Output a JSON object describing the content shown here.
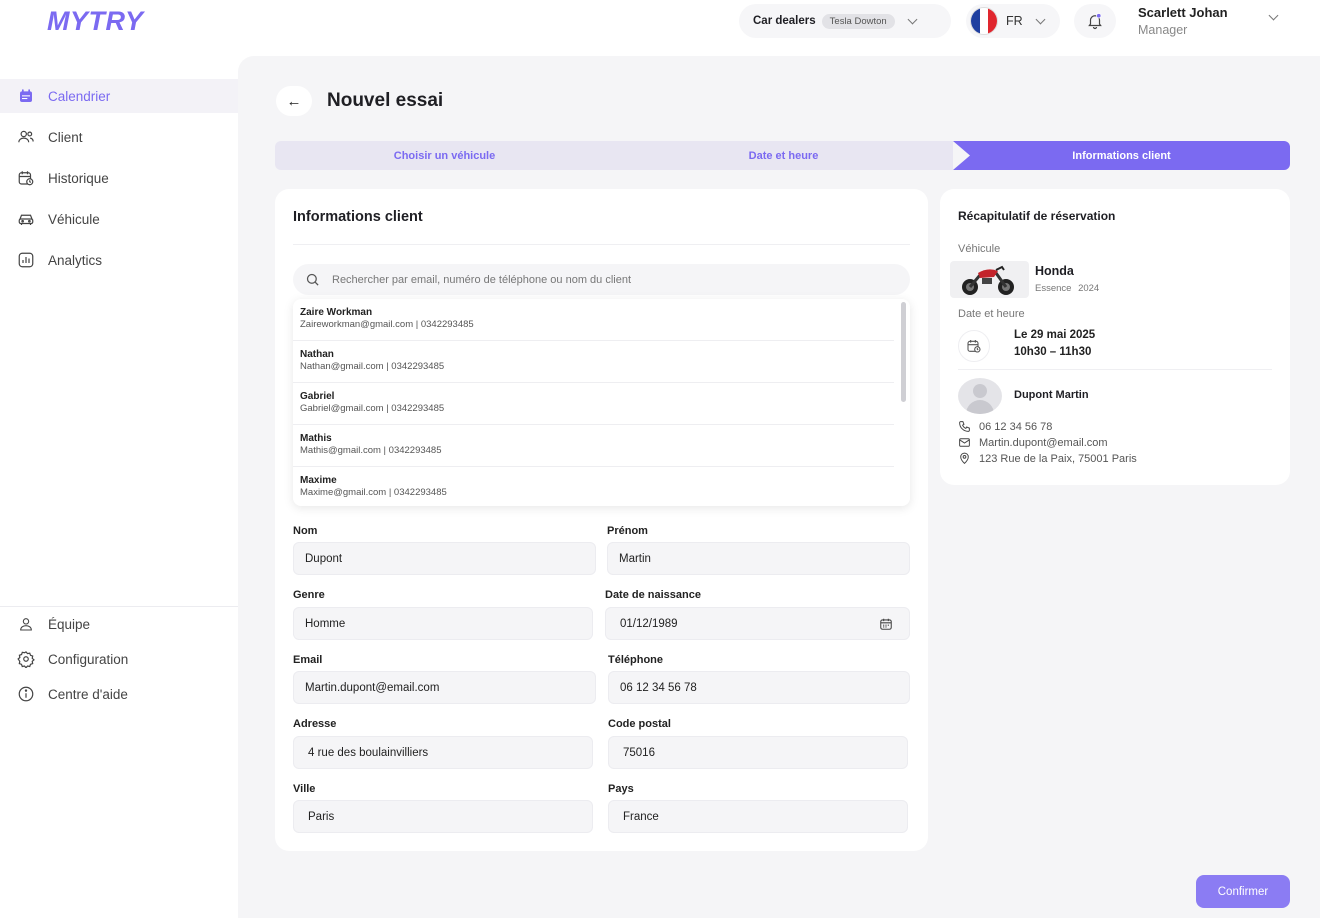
{
  "app": {
    "logo": "MYTRY"
  },
  "header": {
    "dealer_label": "Car dealers",
    "dealer_value": "Tesla Dowton",
    "language": "FR",
    "user_name": "Scarlett Johan",
    "user_role": "Manager"
  },
  "sidebar": {
    "items": [
      {
        "label": "Calendrier",
        "icon": "calendar-icon",
        "active": true
      },
      {
        "label": "Client",
        "icon": "users-icon"
      },
      {
        "label": "Historique",
        "icon": "history-icon"
      },
      {
        "label": "Véhicule",
        "icon": "car-icon"
      },
      {
        "label": "Analytics",
        "icon": "analytics-icon"
      }
    ],
    "bottom_items": [
      {
        "label": "Équipe",
        "icon": "user-icon"
      },
      {
        "label": "Configuration",
        "icon": "gear-icon"
      },
      {
        "label": "Centre d'aide",
        "icon": "info-icon"
      }
    ]
  },
  "page": {
    "title": "Nouvel essai"
  },
  "stepper": {
    "steps": [
      {
        "label": "Choisir un véhicule"
      },
      {
        "label": "Date et heure"
      },
      {
        "label": "Informations client",
        "active": true
      }
    ]
  },
  "client_form": {
    "title": "Informations client",
    "search_placeholder": "Rechercher par email, numéro de téléphone ou nom du client",
    "suggestions": [
      {
        "name": "Zaire Workman",
        "detail": "Zaireworkman@gmail.com | 0342293485"
      },
      {
        "name": "Nathan",
        "detail": "Nathan@gmail.com | 0342293485"
      },
      {
        "name": "Gabriel",
        "detail": "Gabriel@gmail.com | 0342293485"
      },
      {
        "name": "Mathis",
        "detail": "Mathis@gmail.com | 0342293485"
      },
      {
        "name": "Maxime",
        "detail": "Maxime@gmail.com | 0342293485"
      }
    ],
    "fields": {
      "nom": {
        "label": "Nom",
        "value": "Dupont"
      },
      "prenom": {
        "label": "Prénom",
        "value": "Martin"
      },
      "genre": {
        "label": "Genre",
        "value": "Homme"
      },
      "naissance": {
        "label": "Date de naissance",
        "value": "01/12/1989"
      },
      "email": {
        "label": "Email",
        "value": "Martin.dupont@email.com"
      },
      "telephone": {
        "label": "Téléphone",
        "value": "06 12 34 56 78"
      },
      "adresse": {
        "label": "Adresse",
        "value": "4 rue des boulainvilliers"
      },
      "code_postal": {
        "label": "Code postal",
        "value": "75016"
      },
      "ville": {
        "label": "Ville",
        "value": "Paris"
      },
      "pays": {
        "label": "Pays",
        "value": "France"
      }
    }
  },
  "recap": {
    "title": "Récapitulatif de réservation",
    "vehicle_label": "Véhicule",
    "vehicle_name": "Honda",
    "vehicle_fuel": "Essence",
    "vehicle_year": "2024",
    "datetime_label": "Date et heure",
    "date": "Le 29 mai 2025",
    "time": "10h30 – 11h30",
    "client_name": "Dupont Martin",
    "phone": "06 12 34 56 78",
    "email": "Martin.dupont@email.com",
    "address": "123 Rue de la Paix, 75001 Paris"
  },
  "actions": {
    "confirm_label": "Confirmer"
  },
  "colors": {
    "accent": "#7b6af1",
    "accent_light": "#e8e6f2",
    "background": "#f5f5f7"
  }
}
